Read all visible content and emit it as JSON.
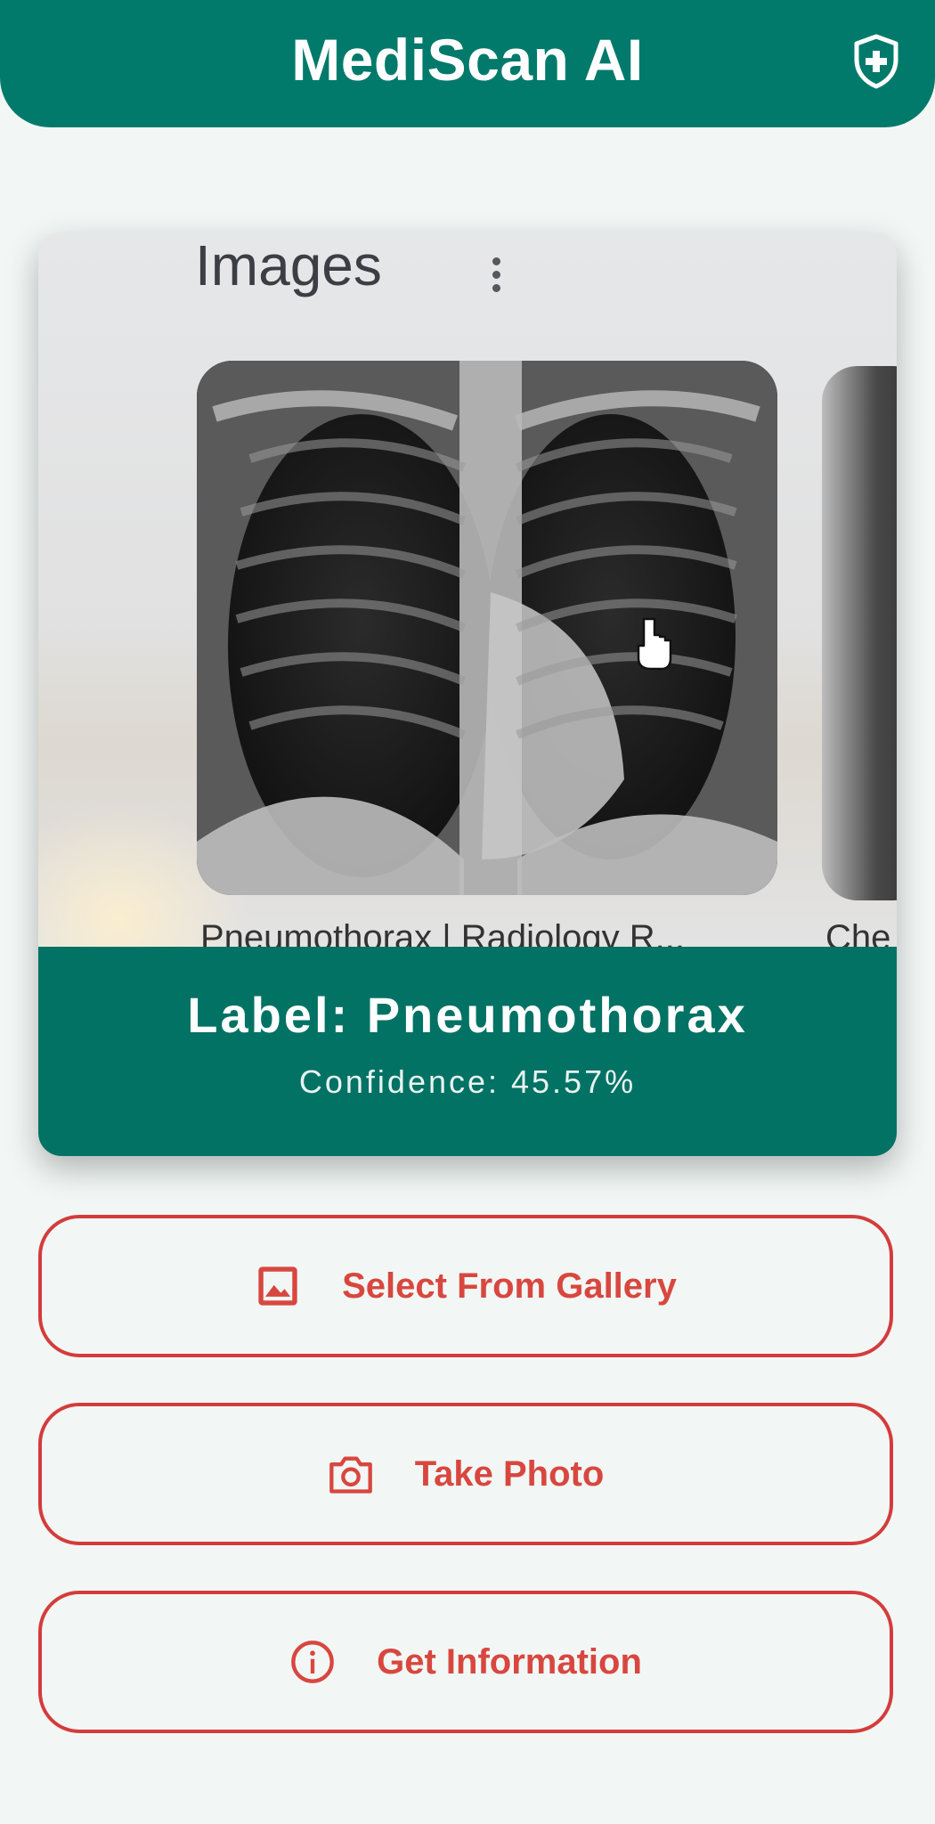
{
  "app": {
    "title": "MediScan AI",
    "shield_icon": "shield-plus-icon",
    "colors": {
      "primary": "#017a6b",
      "accent": "#d43c3c",
      "background": "#f2f7f5"
    }
  },
  "preview": {
    "photo_heading": "Images",
    "photo_caption": "Pneumothorax | Radiology R...",
    "photo_caption_partial": "Che",
    "kebab_icon": "more-vertical-icon"
  },
  "result": {
    "label": "Label: Pneumothorax",
    "confidence": "Confidence: 45.57%"
  },
  "actions": [
    {
      "label": "Select From Gallery",
      "icon": "image-icon"
    },
    {
      "label": "Take Photo",
      "icon": "camera-icon"
    },
    {
      "label": "Get Information",
      "icon": "info-icon"
    }
  ]
}
